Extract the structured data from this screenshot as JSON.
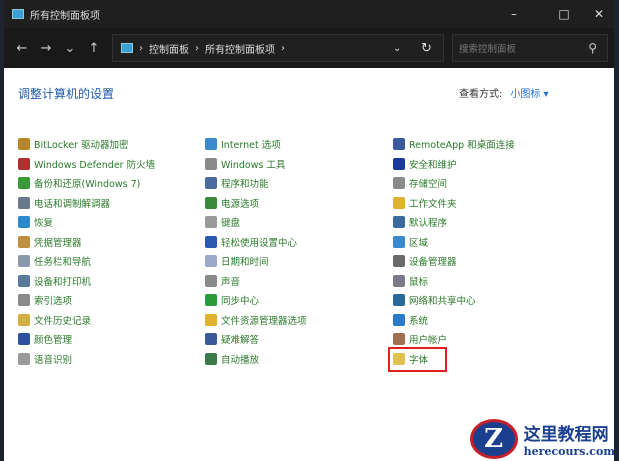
{
  "window": {
    "title": "所有控制面板项",
    "minimize": "–",
    "maximize": "□",
    "close": "✕"
  },
  "nav": {
    "back": "←",
    "forward": "→",
    "recent": "⌄",
    "up": "↑",
    "breadcrumb": [
      "控制面板",
      "所有控制面板项"
    ],
    "sep": "›",
    "dropdown": "⌄",
    "refresh": "↻",
    "search_placeholder": "搜索控制面板",
    "search_icon": "⚲"
  },
  "main": {
    "heading": "调整计算机的设置",
    "view_label": "查看方式:",
    "view_value": "小图标 ▾"
  },
  "items": [
    {
      "label": "BitLocker 驱动器加密",
      "color": "#b8862a"
    },
    {
      "label": "Windows Defender 防火墙",
      "color": "#b03030"
    },
    {
      "label": "备份和还原(Windows 7)",
      "color": "#3a9a3a"
    },
    {
      "label": "电话和调制解调器",
      "color": "#6a7a8a"
    },
    {
      "label": "恢复",
      "color": "#2a8acc"
    },
    {
      "label": "凭据管理器",
      "color": "#c09040"
    },
    {
      "label": "任务栏和导航",
      "color": "#8a9aaa"
    },
    {
      "label": "设备和打印机",
      "color": "#5a7a9a"
    },
    {
      "label": "索引选项",
      "color": "#8a8a8a"
    },
    {
      "label": "文件历史记录",
      "color": "#d0b040"
    },
    {
      "label": "颜色管理",
      "color": "#3050a0"
    },
    {
      "label": "语音识别",
      "color": "#9a9a9a"
    },
    {
      "label": "Internet 选项",
      "color": "#3a8acc"
    },
    {
      "label": "Windows 工具",
      "color": "#8a8a8a"
    },
    {
      "label": "程序和功能",
      "color": "#4a6aa0"
    },
    {
      "label": "电源选项",
      "color": "#3a8a3a"
    },
    {
      "label": "键盘",
      "color": "#9a9a9a"
    },
    {
      "label": "轻松使用设置中心",
      "color": "#2a5ab0"
    },
    {
      "label": "日期和时间",
      "color": "#9aaacc"
    },
    {
      "label": "声音",
      "color": "#8a8a8a"
    },
    {
      "label": "同步中心",
      "color": "#2a9a3a"
    },
    {
      "label": "文件资源管理器选项",
      "color": "#e0b030"
    },
    {
      "label": "疑难解答",
      "color": "#3a5a9a"
    },
    {
      "label": "自动播放",
      "color": "#3a7a4a"
    },
    {
      "label": "RemoteApp 和桌面连接",
      "color": "#3a5aa0"
    },
    {
      "label": "安全和维护",
      "color": "#1a3a9a"
    },
    {
      "label": "存储空间",
      "color": "#8a8a8a"
    },
    {
      "label": "工作文件夹",
      "color": "#e0b030"
    },
    {
      "label": "默认程序",
      "color": "#3a6aa0"
    },
    {
      "label": "区域",
      "color": "#3a8acc"
    },
    {
      "label": "设备管理器",
      "color": "#6a6a6a"
    },
    {
      "label": "鼠标",
      "color": "#7a7a8a"
    },
    {
      "label": "网络和共享中心",
      "color": "#2a6a9a"
    },
    {
      "label": "系统",
      "color": "#2a7acc"
    },
    {
      "label": "用户帐户",
      "color": "#a07050"
    },
    {
      "label": "字体",
      "color": "#e0c050"
    }
  ],
  "watermark": {
    "logo": "Z",
    "name": "这里教程网",
    "url": "herecours.com"
  }
}
